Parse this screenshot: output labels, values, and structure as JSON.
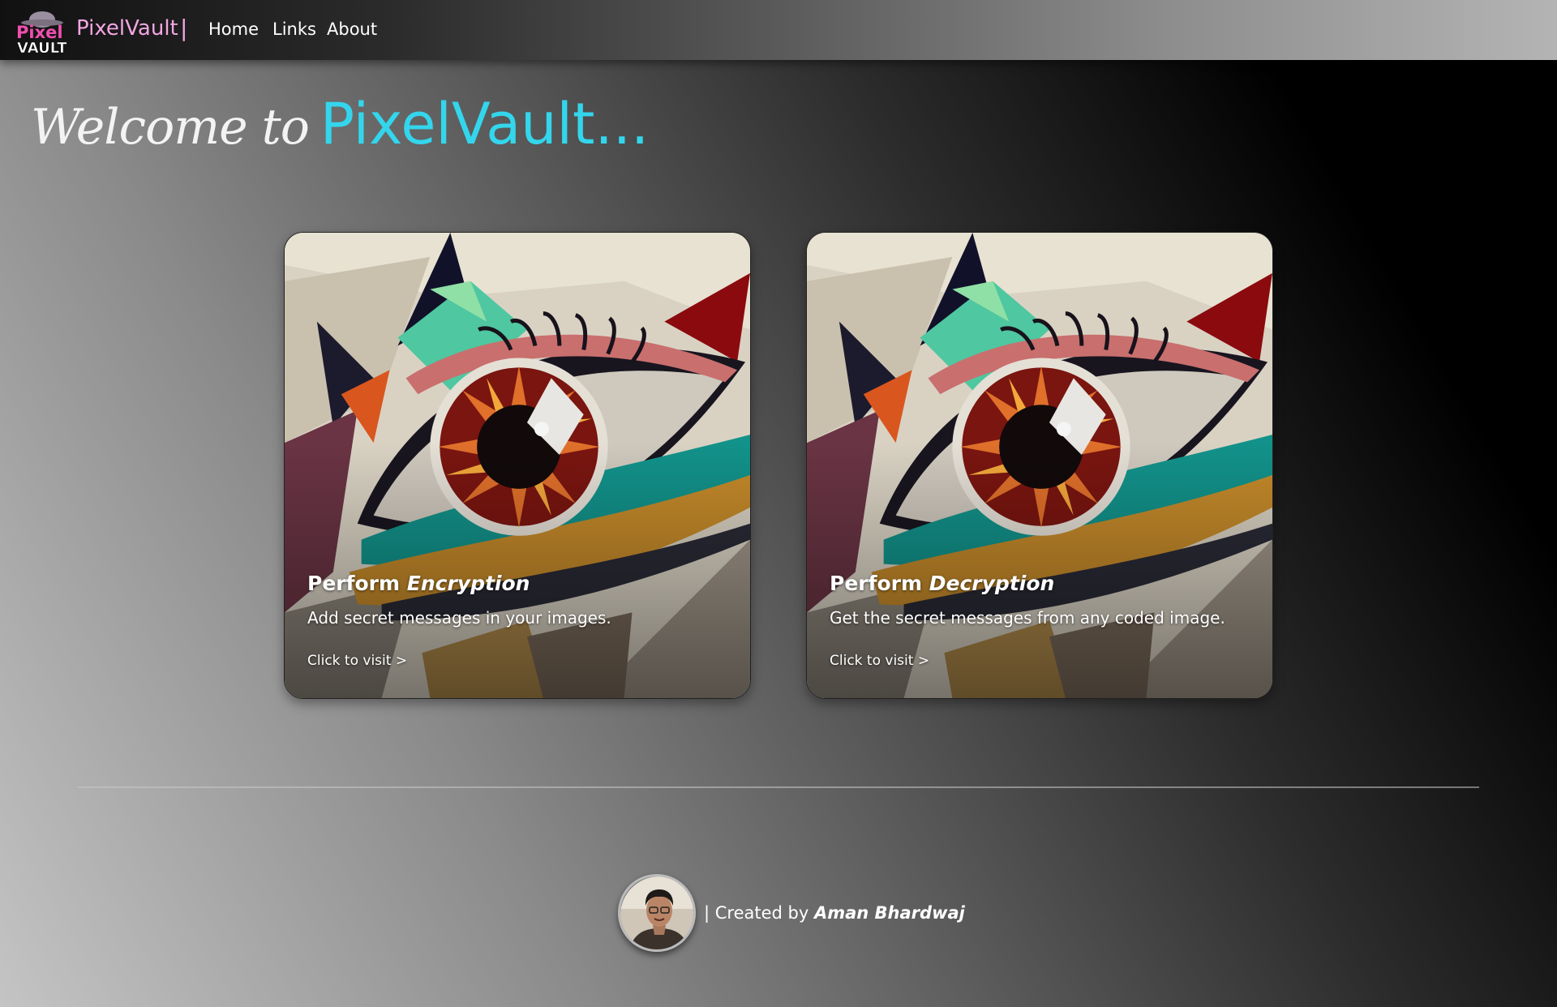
{
  "navbar": {
    "logo_text_top": "Pixel",
    "logo_text_bottom": "VAULT",
    "brand": "PixelVault",
    "separator": "|",
    "links": [
      "Home",
      "Links",
      "About"
    ]
  },
  "hero": {
    "welcome": "Welcome to",
    "brand": "PixelVault..."
  },
  "cards": [
    {
      "title_prefix": "Perform",
      "title_emphasis": "Encryption",
      "description": "Add secret messages in your images.",
      "visit": "Click to visit >"
    },
    {
      "title_prefix": "Perform",
      "title_emphasis": "Decryption",
      "description": "Get the secret messages from any coded image.",
      "visit": "Click to visit >"
    }
  ],
  "footer": {
    "prefix": "| Created by",
    "author": "Aman Bhardwaj"
  },
  "colors": {
    "brand_pink": "#f2a6e2",
    "hero_cyan": "#33d6ec"
  }
}
